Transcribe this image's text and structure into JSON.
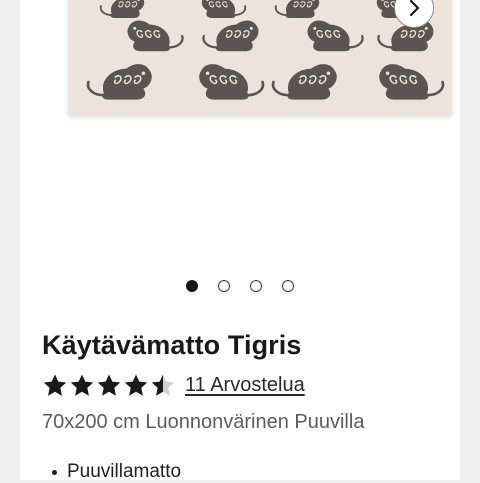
{
  "product": {
    "title": "Käytävämatto Tigris",
    "rating": 4.5,
    "rating_max": 5,
    "reviews_label": "11 Arvostelua",
    "subtitle": "70x200 cm Luonnonvärinen Puuvilla",
    "features": [
      "Puuvillamatto"
    ]
  },
  "gallery": {
    "slide_count": 4,
    "active_slide": 1,
    "next_icon": "chevron-right-icon"
  },
  "colors": {
    "rug_background": "#ece4dc",
    "tiger_pattern": "#5a5550",
    "star_filled": "#1a1a1a",
    "star_empty": "#cfcfcf",
    "active_dot": "#151515"
  }
}
